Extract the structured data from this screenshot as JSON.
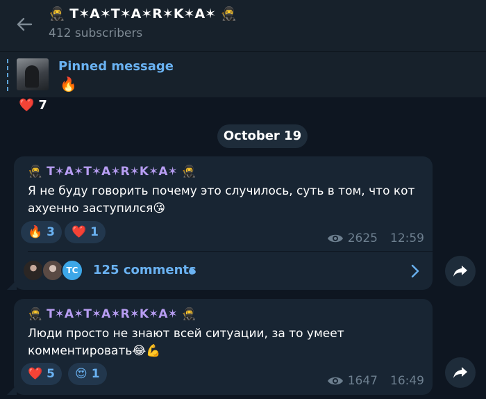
{
  "header": {
    "title": "🥷 T⁣✶A✶T✶A✶R✶K✶A✶ 🥷",
    "subtitle": "412 subscribers"
  },
  "pinned": {
    "title": "Pinned message",
    "preview": "🔥"
  },
  "top_reaction": {
    "emoji": "❤️",
    "count": "7"
  },
  "date_label": "October 19",
  "messages": [
    {
      "author": "🥷 T✶A✶T✶A✶R✶K✶A✶ 🥷",
      "text": "Я не буду говорить почему это случилось, суть в том, что кот ахуенно заступился😘",
      "reactions": [
        {
          "emoji": "🔥",
          "count": "3"
        },
        {
          "emoji": "❤️",
          "count": "1"
        }
      ],
      "views": "2625",
      "time": "12:59",
      "comments": "125 comments",
      "commenter_initials": "TC"
    },
    {
      "author": "🥷 T✶A✶T✶A✶R✶K✶A✶ 🥷",
      "text": "Люди просто не знают всей ситуации, за то умеет комментировать😂💪",
      "reactions": [
        {
          "emoji": "❤️",
          "count": "5"
        },
        {
          "emoji": "😍",
          "count": "1"
        }
      ],
      "views": "1647",
      "time": "16:49"
    }
  ],
  "colors": {
    "background": "#0e1621",
    "header": "#17212b",
    "bubble": "#182533",
    "accent": "#6ab2f2",
    "author": "#b79df2",
    "meta": "#6d7f8f"
  },
  "icons": {
    "back": "arrow-left-icon",
    "views": "eye-icon",
    "share": "share-arrow-icon",
    "comments_open": "chevron-right-icon"
  }
}
